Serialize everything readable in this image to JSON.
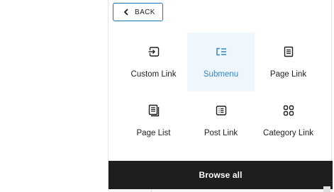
{
  "back_button": {
    "label": "BACK"
  },
  "blocks": [
    {
      "label": "Custom Link",
      "icon": "custom-link-icon",
      "selected": false
    },
    {
      "label": "Submenu",
      "icon": "submenu-icon",
      "selected": true
    },
    {
      "label": "Page Link",
      "icon": "page-link-icon",
      "selected": false
    },
    {
      "label": "Page List",
      "icon": "page-list-icon",
      "selected": false
    },
    {
      "label": "Post Link",
      "icon": "post-link-icon",
      "selected": false
    },
    {
      "label": "Category Link",
      "icon": "category-link-icon",
      "selected": false
    }
  ],
  "browse_all": {
    "label": "Browse all"
  },
  "colors": {
    "accent": "#2271b1",
    "selected_bg": "#f0f7fc",
    "selected_fg": "#3584c4",
    "bar_bg": "#1e1e1e"
  }
}
